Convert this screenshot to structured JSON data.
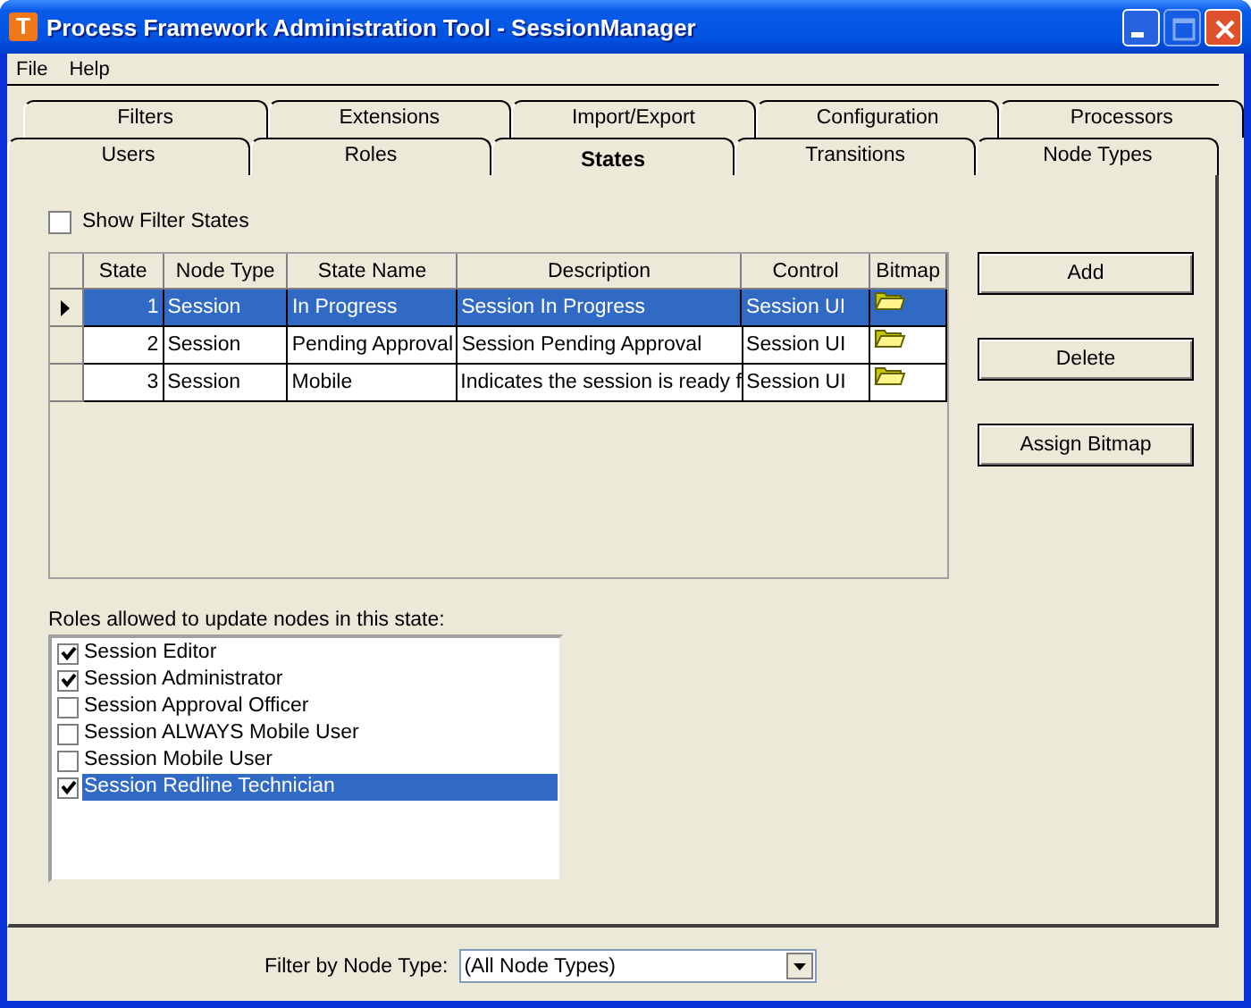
{
  "window": {
    "icon_letter": "T",
    "title": "Process Framework Administration Tool - SessionManager",
    "maximize_disabled": true
  },
  "menu": [
    "File",
    "Help"
  ],
  "tab_rows": [
    [
      {
        "label": "Filters",
        "selected": false
      },
      {
        "label": "Extensions",
        "selected": false
      },
      {
        "label": "Import/Export",
        "selected": false
      },
      {
        "label": "Configuration",
        "selected": false
      },
      {
        "label": "Processors",
        "selected": false
      }
    ],
    [
      {
        "label": "Users",
        "selected": false
      },
      {
        "label": "Roles",
        "selected": false
      },
      {
        "label": "States",
        "selected": true
      },
      {
        "label": "Transitions",
        "selected": false
      },
      {
        "label": "Node Types",
        "selected": false
      }
    ]
  ],
  "show_filter_states": {
    "label": "Show Filter States",
    "checked": false
  },
  "table": {
    "columns": [
      "State",
      "Node Type",
      "State Name",
      "Description",
      "Control",
      "Bitmap"
    ],
    "rows": [
      {
        "state": "1",
        "node_type": "Session",
        "state_name": "In Progress",
        "description": "Session In Progress",
        "control": "Session UI",
        "selected": true
      },
      {
        "state": "2",
        "node_type": "Session",
        "state_name": "Pending Approval",
        "description": "Session Pending Approval",
        "control": "Session UI",
        "selected": false
      },
      {
        "state": "3",
        "node_type": "Session",
        "state_name": "Mobile",
        "description": "Indicates the session is ready f",
        "control": "Session UI",
        "selected": false
      }
    ]
  },
  "buttons": [
    "Add",
    "Delete",
    "Assign Bitmap"
  ],
  "roles": {
    "label": "Roles allowed to update nodes in this state:",
    "items": [
      {
        "label": "Session Editor",
        "checked": true,
        "selected": false
      },
      {
        "label": "Session Administrator",
        "checked": true,
        "selected": false
      },
      {
        "label": "Session Approval Officer",
        "checked": false,
        "selected": false
      },
      {
        "label": "Session ALWAYS Mobile User",
        "checked": false,
        "selected": false
      },
      {
        "label": "Session Mobile User",
        "checked": false,
        "selected": false
      },
      {
        "label": "Session Redline Technician",
        "checked": true,
        "selected": true
      }
    ]
  },
  "filter": {
    "label": "Filter by Node Type:",
    "value": "(All Node Types)"
  }
}
